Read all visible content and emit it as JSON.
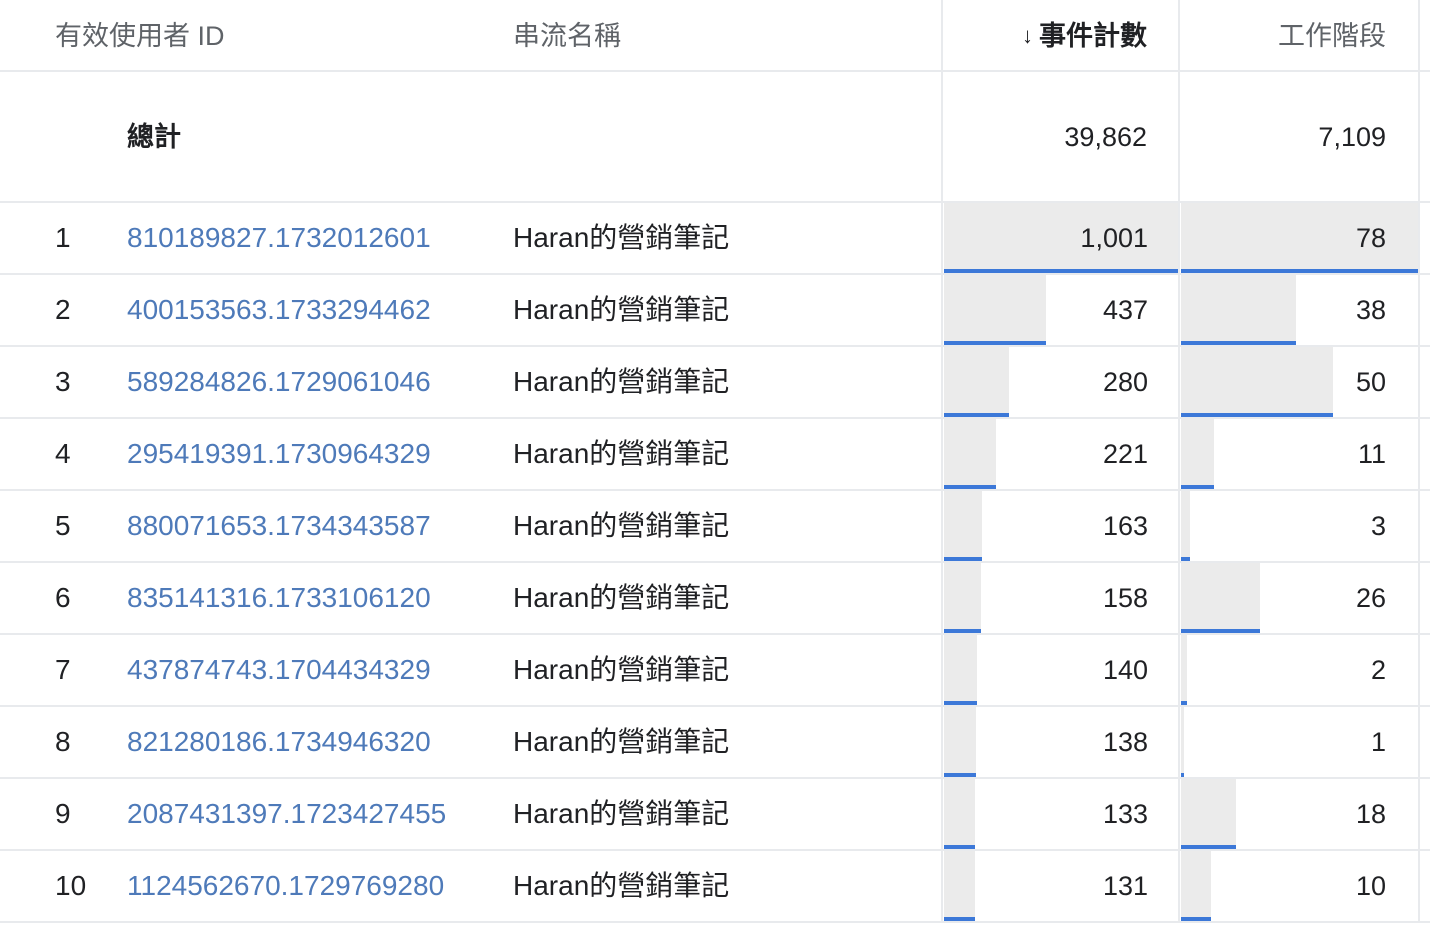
{
  "headers": {
    "user_id": "有效使用者 ID",
    "stream_name": "串流名稱",
    "event_count": "事件計數",
    "sessions": "工作階段",
    "sort_icon": "arrow-down-icon"
  },
  "totals": {
    "label": "總計",
    "event_count": "39,862",
    "sessions": "7,109"
  },
  "rows": [
    {
      "index": "1",
      "user_id": "810189827.1732012601",
      "stream": "Haran的營銷筆記",
      "event_count": "1,001",
      "sessions": "78",
      "event_value": 1001,
      "session_value": 78
    },
    {
      "index": "2",
      "user_id": "400153563.1733294462",
      "stream": "Haran的營銷筆記",
      "event_count": "437",
      "sessions": "38",
      "event_value": 437,
      "session_value": 38
    },
    {
      "index": "3",
      "user_id": "589284826.1729061046",
      "stream": "Haran的營銷筆記",
      "event_count": "280",
      "sessions": "50",
      "event_value": 280,
      "session_value": 50
    },
    {
      "index": "4",
      "user_id": "295419391.1730964329",
      "stream": "Haran的營銷筆記",
      "event_count": "221",
      "sessions": "11",
      "event_value": 221,
      "session_value": 11
    },
    {
      "index": "5",
      "user_id": "880071653.1734343587",
      "stream": "Haran的營銷筆記",
      "event_count": "163",
      "sessions": "3",
      "event_value": 163,
      "session_value": 3
    },
    {
      "index": "6",
      "user_id": "835141316.1733106120",
      "stream": "Haran的營銷筆記",
      "event_count": "158",
      "sessions": "26",
      "event_value": 158,
      "session_value": 26
    },
    {
      "index": "7",
      "user_id": "437874743.1704434329",
      "stream": "Haran的營銷筆記",
      "event_count": "140",
      "sessions": "2",
      "event_value": 140,
      "session_value": 2
    },
    {
      "index": "8",
      "user_id": "821280186.1734946320",
      "stream": "Haran的營銷筆記",
      "event_count": "138",
      "sessions": "1",
      "event_value": 138,
      "session_value": 1
    },
    {
      "index": "9",
      "user_id": "2087431397.1723427455",
      "stream": "Haran的營銷筆記",
      "event_count": "133",
      "sessions": "18",
      "event_value": 133,
      "session_value": 18
    },
    {
      "index": "10",
      "user_id": "1124562670.1729769280",
      "stream": "Haran的營銷筆記",
      "event_count": "131",
      "sessions": "10",
      "event_value": 131,
      "session_value": 10
    }
  ],
  "colors": {
    "link": "#4e7ab9",
    "bar_fill": "#ebebeb",
    "bar_accent": "#3c78d8",
    "divider": "#e8eaed"
  }
}
